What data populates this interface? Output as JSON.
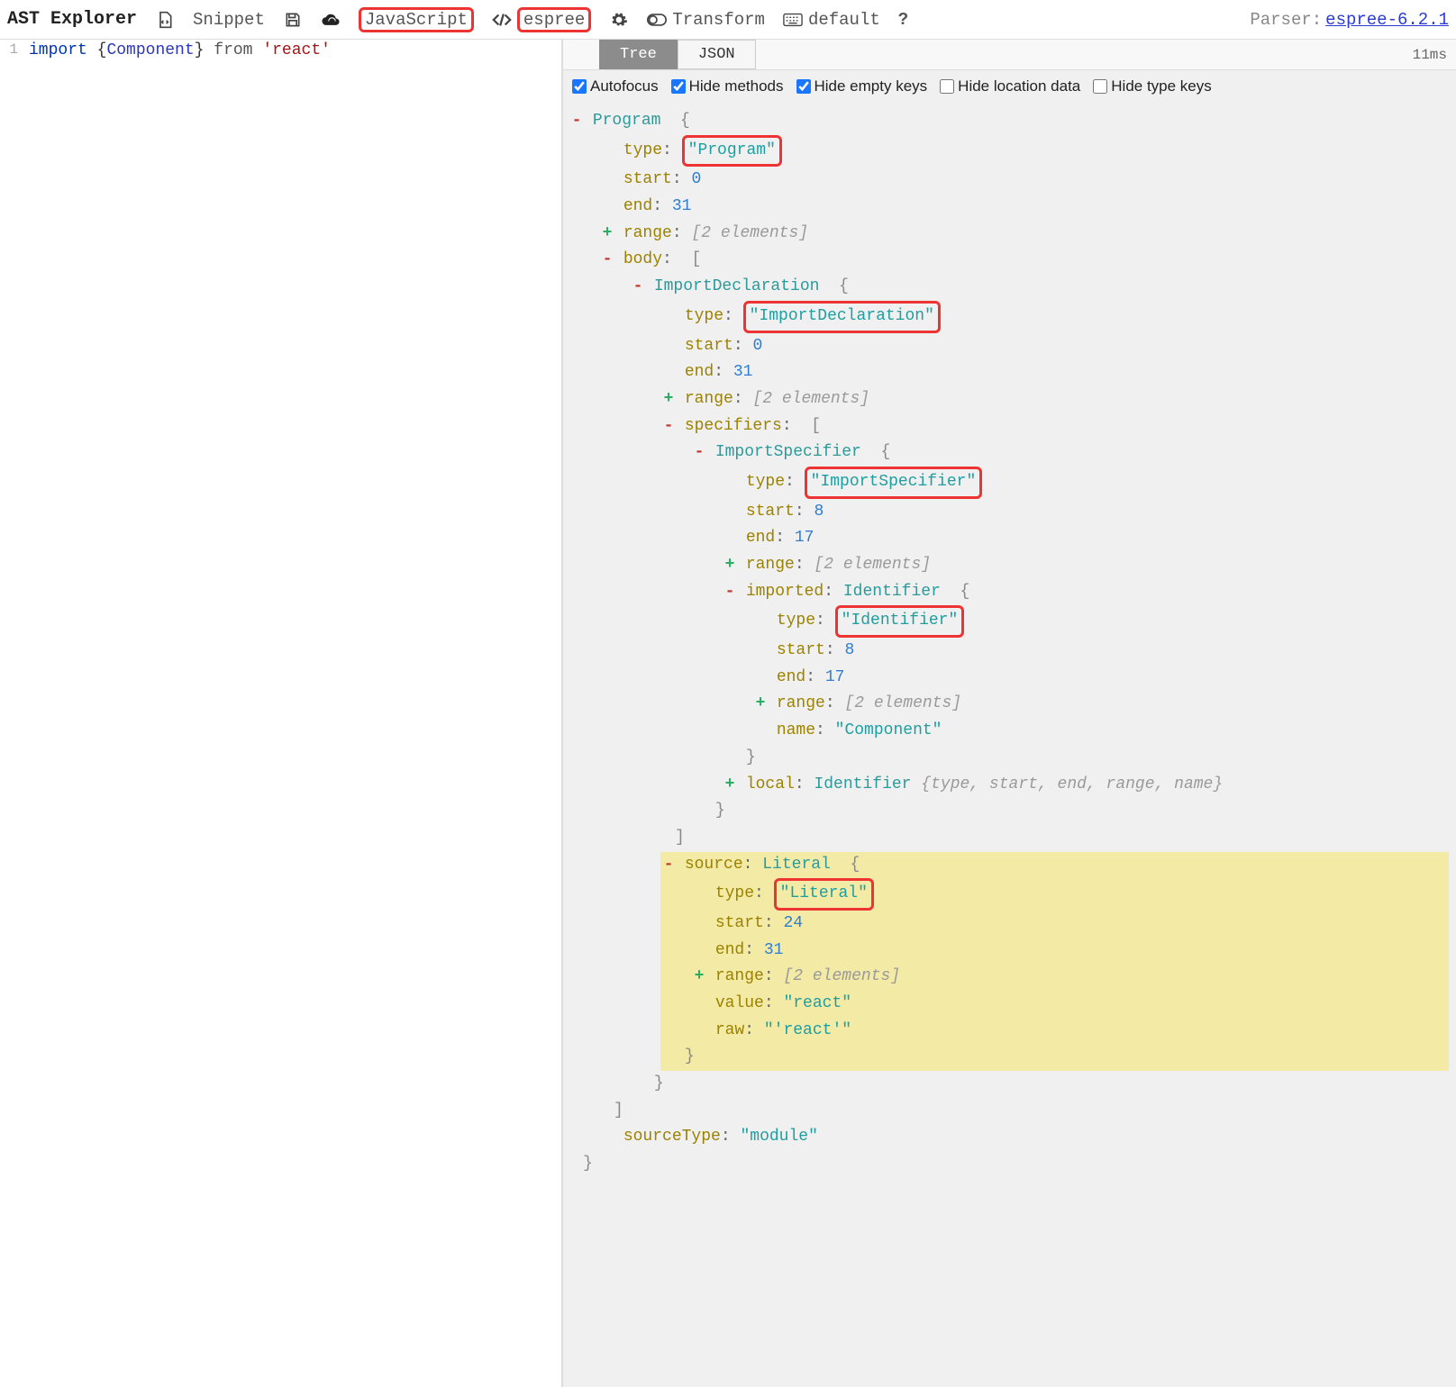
{
  "toolbar": {
    "title": "AST Explorer",
    "snippet": "Snippet",
    "language": "JavaScript",
    "parser": "espree",
    "transform": "Transform",
    "default_label": "default",
    "help": "?",
    "parser_label": "Parser: ",
    "parser_link": "espree-6.2.1"
  },
  "editor": {
    "line_number": "1",
    "tokens": {
      "import": "import",
      "lbrace": "{",
      "component": "Component",
      "rbrace": "}",
      "from": "from",
      "str": "'react'"
    }
  },
  "tabs": {
    "tree": "Tree",
    "json": "JSON",
    "timing": "11ms"
  },
  "options": {
    "autofocus": "Autofocus",
    "hide_methods": "Hide methods",
    "hide_empty": "Hide empty keys",
    "hide_location": "Hide location data",
    "hide_type": "Hide type keys"
  },
  "tree": {
    "program": {
      "name": "Program",
      "type": "\"Program\"",
      "start": "0",
      "end": "31",
      "range_summary": "[2 elements]",
      "body_open": "[",
      "importDecl": {
        "name": "ImportDeclaration",
        "type": "\"ImportDeclaration\"",
        "start": "0",
        "end": "31",
        "range_summary": "[2 elements]",
        "specifiers_open": "[",
        "importSpec": {
          "name": "ImportSpecifier",
          "type": "\"ImportSpecifier\"",
          "start": "8",
          "end": "17",
          "range_summary": "[2 elements]",
          "imported": {
            "label": "imported",
            "name": "Identifier",
            "type": "\"Identifier\"",
            "start": "8",
            "end": "17",
            "range_summary": "[2 elements]",
            "name_key": "name",
            "name_val": "\"Component\""
          },
          "local_label": "local",
          "local_name": "Identifier",
          "local_summary": "{type, start, end, range, name}"
        },
        "source": {
          "label": "source",
          "name": "Literal",
          "type": "\"Literal\"",
          "start": "24",
          "end": "31",
          "range_summary": "[2 elements]",
          "value": "\"react\"",
          "raw": "\"'react'\""
        }
      },
      "sourceType_key": "sourceType",
      "sourceType_val": "\"module\""
    },
    "labels": {
      "type": "type",
      "start": "start",
      "end": "end",
      "range": "range",
      "body": "body",
      "specifiers": "specifiers",
      "value": "value",
      "raw": "raw"
    }
  }
}
